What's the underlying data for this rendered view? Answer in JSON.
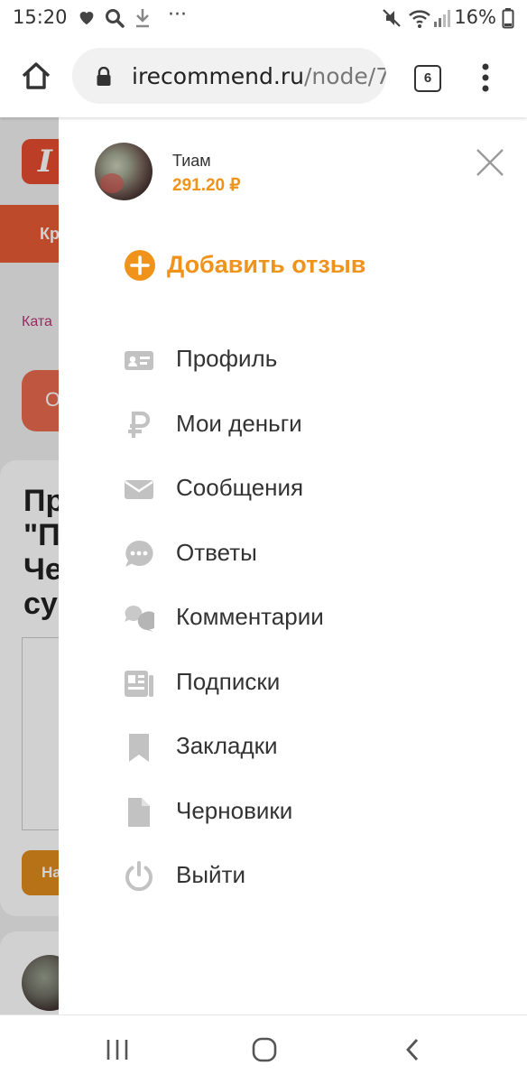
{
  "status_bar": {
    "time": "15:20",
    "battery": "16%"
  },
  "browser": {
    "url_host": "irecommend.ru",
    "url_path": "/node/7",
    "tab_count": "6"
  },
  "background_page": {
    "nav_item": "Кр",
    "breadcrumb": "Ката",
    "pill_label": "О",
    "title_lines": [
      "Пр",
      "\"П",
      "Че",
      "су"
    ],
    "button_label": "На"
  },
  "drawer": {
    "user": {
      "name": "Тиам",
      "balance": "291.20 ₽"
    },
    "add_review_label": "Добавить отзыв",
    "menu": [
      {
        "label": "Профиль",
        "icon": "profile-card-icon"
      },
      {
        "label": "Мои деньги",
        "icon": "ruble-icon"
      },
      {
        "label": "Сообщения",
        "icon": "envelope-icon"
      },
      {
        "label": "Ответы",
        "icon": "chat-bubble-icon"
      },
      {
        "label": "Комментарии",
        "icon": "comments-icon"
      },
      {
        "label": "Подписки",
        "icon": "newspaper-icon"
      },
      {
        "label": "Закладки",
        "icon": "bookmark-icon"
      },
      {
        "label": "Черновики",
        "icon": "document-icon"
      },
      {
        "label": "Выйти",
        "icon": "power-icon"
      }
    ]
  },
  "colors": {
    "accent": "#f0931b",
    "icon_gray": "#bdbdbd",
    "brand_red": "#e74c2f"
  }
}
